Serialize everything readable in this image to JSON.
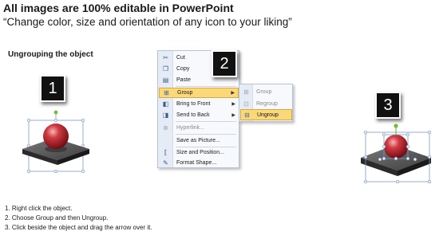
{
  "header": {
    "title": "All images are 100% editable in PowerPoint",
    "subtitle": "“Change color, size and orientation of any icon to your liking”"
  },
  "section_label": "Ungrouping the object",
  "badges": [
    "1",
    "2",
    "3"
  ],
  "context_menu": {
    "items": [
      {
        "icon": "cut-icon",
        "label": "Cut"
      },
      {
        "icon": "copy-icon",
        "label": "Copy"
      },
      {
        "icon": "paste-icon",
        "label": "Paste"
      },
      {
        "icon": "group-icon",
        "label": "Group",
        "highlighted": true,
        "has_submenu": true
      },
      {
        "icon": "bring-to-front-icon",
        "label": "Bring to Front",
        "has_submenu": true
      },
      {
        "icon": "send-to-back-icon",
        "label": "Send to Back",
        "has_submenu": true
      },
      {
        "icon": "hyperlink-icon",
        "label": "Hyperlink...",
        "disabled": true
      },
      {
        "icon": "save-as-picture-icon",
        "label": "Save as Picture..."
      },
      {
        "icon": "size-position-icon",
        "label": "Size and Position..."
      },
      {
        "icon": "format-shape-icon",
        "label": "Format Shape..."
      }
    ]
  },
  "submenu": {
    "items": [
      {
        "icon": "group-icon",
        "label": "Group",
        "disabled": true
      },
      {
        "icon": "regroup-icon",
        "label": "Regroup",
        "disabled": true
      },
      {
        "icon": "ungroup-icon",
        "label": "Ungroup",
        "highlighted": true
      }
    ]
  },
  "steps": [
    "1.  Right click the object.",
    "2.  Choose Group and then Ungroup.",
    "3.  Click beside the object and drag the arrow over it."
  ],
  "colors": {
    "highlight": "#fbd97a",
    "sphere": "#b0232a",
    "platform_top": "#5a5a5a",
    "selection_handle": "#6fbf3a"
  }
}
